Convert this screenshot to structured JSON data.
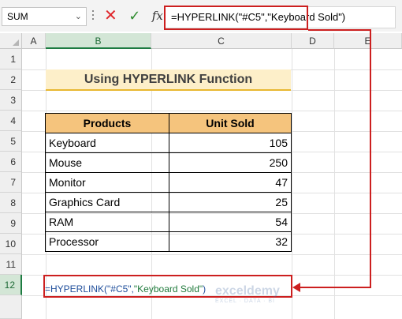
{
  "formula_bar": {
    "name_box": "SUM",
    "formula": "=HYPERLINK(\"#C5\",\"Keyboard Sold\")"
  },
  "columns": [
    "A",
    "B",
    "C",
    "D",
    "E"
  ],
  "rows": [
    "1",
    "2",
    "3",
    "4",
    "5",
    "6",
    "7",
    "8",
    "9",
    "10",
    "11",
    "12"
  ],
  "title": "Using HYPERLINK Function",
  "table": {
    "headers": [
      "Products",
      "Unit Sold"
    ],
    "rows": [
      {
        "product": "Keyboard",
        "units": "105"
      },
      {
        "product": "Mouse",
        "units": "250"
      },
      {
        "product": "Monitor",
        "units": "47"
      },
      {
        "product": "Graphics Card",
        "units": "25"
      },
      {
        "product": "RAM",
        "units": "54"
      },
      {
        "product": "Processor",
        "units": "32"
      }
    ]
  },
  "active_cell": {
    "part1": "=HYPERLINK(\"#C5\",",
    "part2": "\"Keyboard Sold\"",
    "part3": ")"
  },
  "watermark": {
    "name": "exceldemy",
    "tagline": "EXCEL · DATA · BI"
  },
  "colors": {
    "accent_red": "#cc1f1f",
    "header_fill": "#f5c47d",
    "title_fill": "#fdefc9"
  }
}
